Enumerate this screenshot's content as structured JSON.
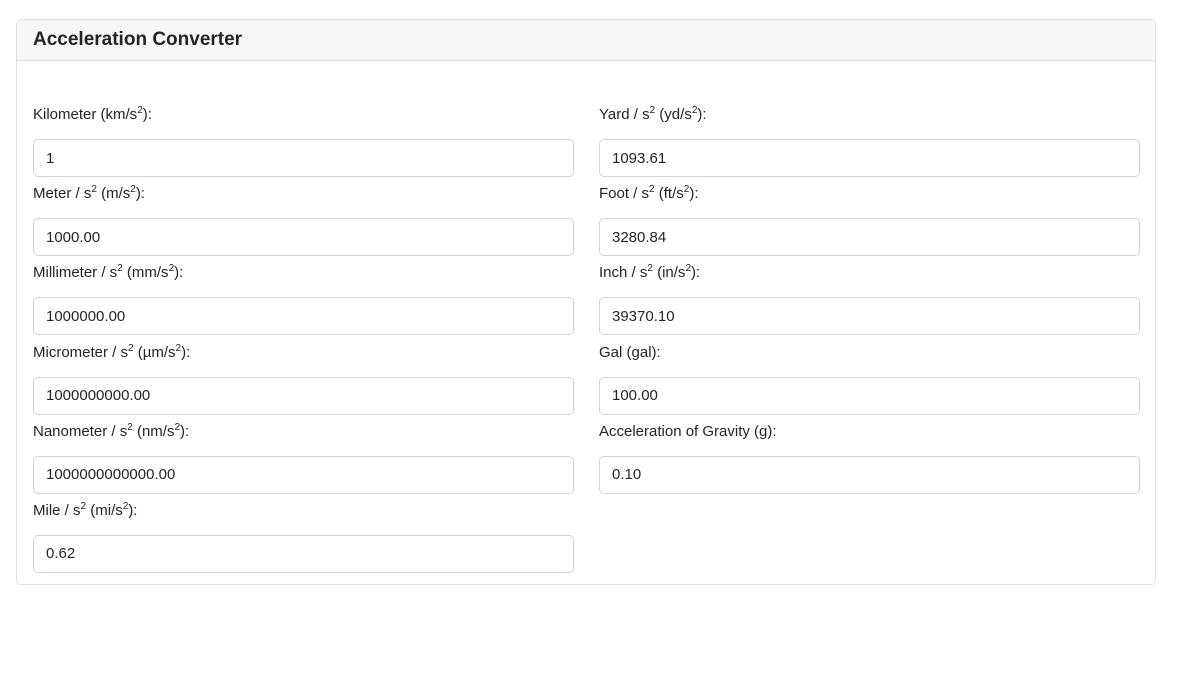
{
  "title": "Acceleration Converter",
  "left_fields": [
    {
      "label_pre": "Kilometer (km/s",
      "label_post": "):",
      "value": "1"
    },
    {
      "label_pre": "Meter / s",
      "label_mid": " (m/s",
      "label_post": "):",
      "value": "1000.00"
    },
    {
      "label_pre": "Millimeter / s",
      "label_mid": " (mm/s",
      "label_post": "):",
      "value": "1000000.00"
    },
    {
      "label_pre": "Micrometer / s",
      "label_mid": " (µm/s",
      "label_post": "):",
      "value": "1000000000.00"
    },
    {
      "label_pre": "Nanometer / s",
      "label_mid": " (nm/s",
      "label_post": "):",
      "value": "1000000000000.00"
    },
    {
      "label_pre": "Mile / s",
      "label_mid": " (mi/s",
      "label_post": "):",
      "value": "0.62"
    }
  ],
  "right_fields": [
    {
      "label_pre": "Yard / s",
      "label_mid": " (yd/s",
      "label_post": "):",
      "value": "1093.61"
    },
    {
      "label_pre": "Foot / s",
      "label_mid": " (ft/s",
      "label_post": "):",
      "value": "3280.84"
    },
    {
      "label_pre": "Inch / s",
      "label_mid": " (in/s",
      "label_post": "):",
      "value": "39370.10"
    },
    {
      "label_text": "Gal (gal):",
      "value": "100.00"
    },
    {
      "label_text": "Acceleration of Gravity (g):",
      "value": "0.10"
    }
  ],
  "superscript": "2"
}
